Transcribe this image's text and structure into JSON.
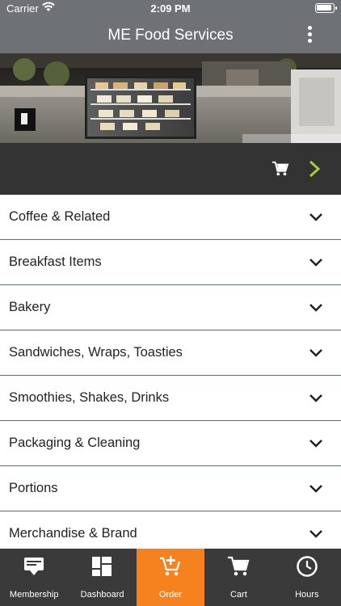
{
  "status": {
    "carrier": "Carrier",
    "time": "2:09 PM"
  },
  "header": {
    "title": "ME Food Services"
  },
  "categories": [
    {
      "label": "Coffee & Related"
    },
    {
      "label": "Breakfast Items"
    },
    {
      "label": "Bakery"
    },
    {
      "label": "Sandwiches, Wraps, Toasties"
    },
    {
      "label": "Smoothies, Shakes, Drinks"
    },
    {
      "label": "Packaging & Cleaning"
    },
    {
      "label": "Portions"
    },
    {
      "label": "Merchandise & Brand"
    }
  ],
  "tabs": [
    {
      "label": "Membership",
      "icon": "membership-icon"
    },
    {
      "label": "Dashboard",
      "icon": "dashboard-icon"
    },
    {
      "label": "Order",
      "icon": "add-to-cart-icon",
      "active": true
    },
    {
      "label": "Cart",
      "icon": "cart-icon"
    },
    {
      "label": "Hours",
      "icon": "clock-icon"
    }
  ],
  "colors": {
    "bar": "#6e7277",
    "cartbar": "#333333",
    "accent": "#f6821f",
    "next_arrow": "#a6ce39",
    "tabbar": "#3a3a3a"
  }
}
